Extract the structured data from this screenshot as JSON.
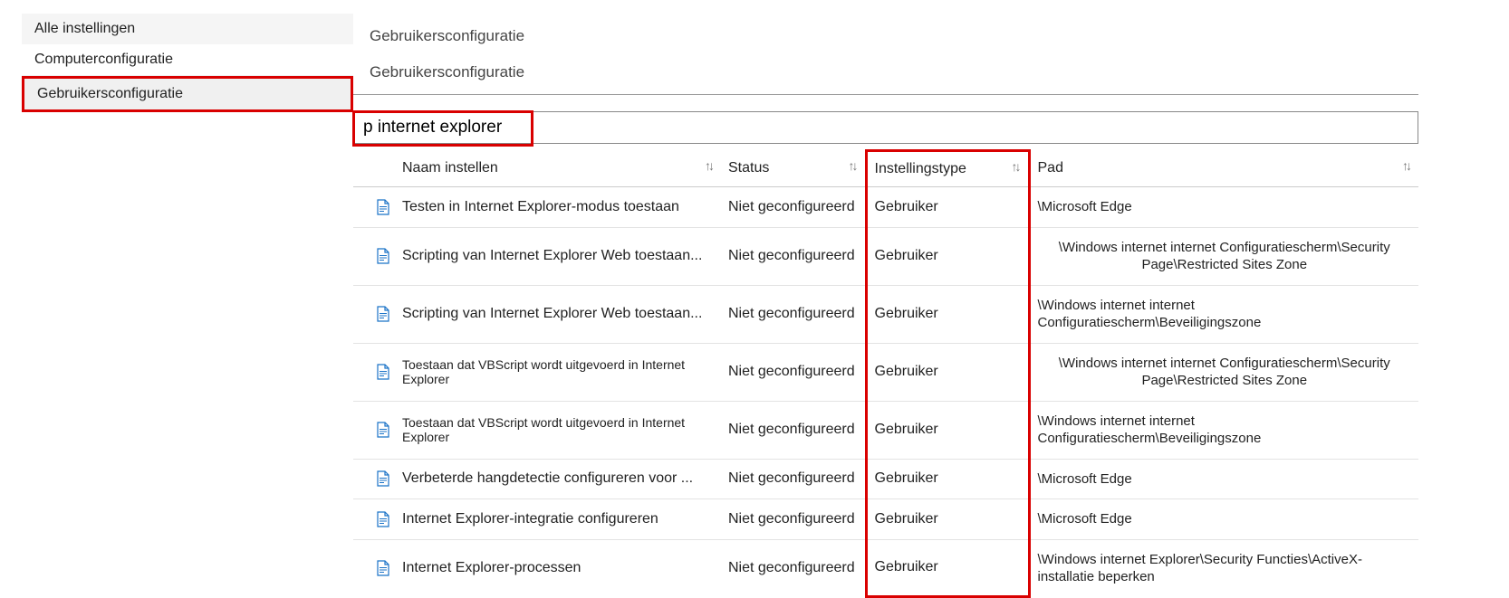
{
  "sidebar": {
    "items": [
      {
        "label": "Alle instellingen"
      },
      {
        "label": "Computerconfiguratie"
      },
      {
        "label": "Gebruikersconfiguratie"
      }
    ]
  },
  "header": {
    "crumb1": "Gebruikersconfiguratie",
    "crumb2": "Gebruikersconfiguratie"
  },
  "search": {
    "value": "p internet explorer"
  },
  "columns": {
    "name": "Naam instellen",
    "status": "Status",
    "type": "Instellingstype",
    "path": "Pad"
  },
  "rows": [
    {
      "name": "Testen in Internet Explorer-modus toestaan",
      "status": "Niet geconfigureerd",
      "type": "Gebruiker",
      "path": "\\Microsoft Edge",
      "small": false,
      "centerPath": false
    },
    {
      "name": "Scripting van Internet Explorer Web toestaan...",
      "status": "Niet geconfigureerd",
      "type": "Gebruiker",
      "path": "\\Windows internet internet Configuratiescherm\\Security Page\\Restricted Sites Zone",
      "small": false,
      "centerPath": true
    },
    {
      "name": "Scripting van Internet Explorer Web toestaan...",
      "status": "Niet geconfigureerd",
      "type": "Gebruiker",
      "path": "\\Windows internet internet Configuratiescherm\\Beveiligingszone",
      "small": false,
      "centerPath": false
    },
    {
      "name": "Toestaan dat VBScript wordt uitgevoerd in Internet Explorer",
      "status": "Niet geconfigureerd",
      "type": "Gebruiker",
      "path": "\\Windows internet internet Configuratiescherm\\Security Page\\Restricted Sites Zone",
      "small": true,
      "centerPath": true
    },
    {
      "name": "Toestaan dat VBScript wordt uitgevoerd in Internet Explorer",
      "status": "Niet geconfigureerd",
      "type": "Gebruiker",
      "path": "\\Windows internet internet Configuratiescherm\\Beveiligingszone",
      "small": true,
      "centerPath": false
    },
    {
      "name": "Verbeterde hangdetectie configureren voor ...",
      "status": "Niet geconfigureerd",
      "type": "Gebruiker",
      "path": "\\Microsoft Edge",
      "small": false,
      "centerPath": false
    },
    {
      "name": "Internet Explorer-integratie configureren",
      "status": "Niet geconfigureerd",
      "type": "Gebruiker",
      "path": "\\Microsoft Edge",
      "small": false,
      "centerPath": false
    },
    {
      "name": "Internet Explorer-processen",
      "status": "Niet geconfigureerd",
      "type": "Gebruiker",
      "path": "\\Windows internet Explorer\\Security Functies\\ActiveX-installatie beperken",
      "small": false,
      "centerPath": false
    }
  ]
}
